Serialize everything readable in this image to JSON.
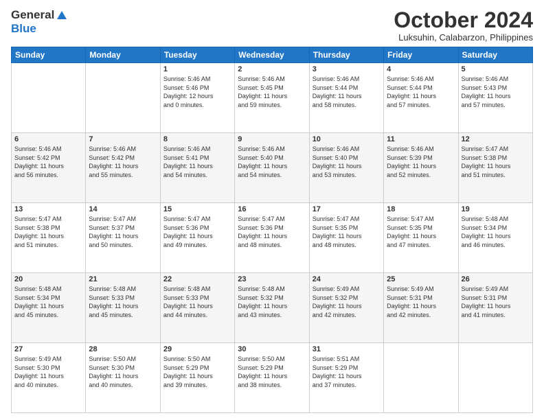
{
  "header": {
    "logo_line1": "General",
    "logo_line2": "Blue",
    "month_title": "October 2024",
    "location": "Luksuhin, Calabarzon, Philippines"
  },
  "days_of_week": [
    "Sunday",
    "Monday",
    "Tuesday",
    "Wednesday",
    "Thursday",
    "Friday",
    "Saturday"
  ],
  "weeks": [
    [
      {
        "day": "",
        "info": ""
      },
      {
        "day": "",
        "info": ""
      },
      {
        "day": "1",
        "info": "Sunrise: 5:46 AM\nSunset: 5:46 PM\nDaylight: 12 hours\nand 0 minutes."
      },
      {
        "day": "2",
        "info": "Sunrise: 5:46 AM\nSunset: 5:45 PM\nDaylight: 11 hours\nand 59 minutes."
      },
      {
        "day": "3",
        "info": "Sunrise: 5:46 AM\nSunset: 5:44 PM\nDaylight: 11 hours\nand 58 minutes."
      },
      {
        "day": "4",
        "info": "Sunrise: 5:46 AM\nSunset: 5:44 PM\nDaylight: 11 hours\nand 57 minutes."
      },
      {
        "day": "5",
        "info": "Sunrise: 5:46 AM\nSunset: 5:43 PM\nDaylight: 11 hours\nand 57 minutes."
      }
    ],
    [
      {
        "day": "6",
        "info": "Sunrise: 5:46 AM\nSunset: 5:42 PM\nDaylight: 11 hours\nand 56 minutes."
      },
      {
        "day": "7",
        "info": "Sunrise: 5:46 AM\nSunset: 5:42 PM\nDaylight: 11 hours\nand 55 minutes."
      },
      {
        "day": "8",
        "info": "Sunrise: 5:46 AM\nSunset: 5:41 PM\nDaylight: 11 hours\nand 54 minutes."
      },
      {
        "day": "9",
        "info": "Sunrise: 5:46 AM\nSunset: 5:40 PM\nDaylight: 11 hours\nand 54 minutes."
      },
      {
        "day": "10",
        "info": "Sunrise: 5:46 AM\nSunset: 5:40 PM\nDaylight: 11 hours\nand 53 minutes."
      },
      {
        "day": "11",
        "info": "Sunrise: 5:46 AM\nSunset: 5:39 PM\nDaylight: 11 hours\nand 52 minutes."
      },
      {
        "day": "12",
        "info": "Sunrise: 5:47 AM\nSunset: 5:38 PM\nDaylight: 11 hours\nand 51 minutes."
      }
    ],
    [
      {
        "day": "13",
        "info": "Sunrise: 5:47 AM\nSunset: 5:38 PM\nDaylight: 11 hours\nand 51 minutes."
      },
      {
        "day": "14",
        "info": "Sunrise: 5:47 AM\nSunset: 5:37 PM\nDaylight: 11 hours\nand 50 minutes."
      },
      {
        "day": "15",
        "info": "Sunrise: 5:47 AM\nSunset: 5:36 PM\nDaylight: 11 hours\nand 49 minutes."
      },
      {
        "day": "16",
        "info": "Sunrise: 5:47 AM\nSunset: 5:36 PM\nDaylight: 11 hours\nand 48 minutes."
      },
      {
        "day": "17",
        "info": "Sunrise: 5:47 AM\nSunset: 5:35 PM\nDaylight: 11 hours\nand 48 minutes."
      },
      {
        "day": "18",
        "info": "Sunrise: 5:47 AM\nSunset: 5:35 PM\nDaylight: 11 hours\nand 47 minutes."
      },
      {
        "day": "19",
        "info": "Sunrise: 5:48 AM\nSunset: 5:34 PM\nDaylight: 11 hours\nand 46 minutes."
      }
    ],
    [
      {
        "day": "20",
        "info": "Sunrise: 5:48 AM\nSunset: 5:34 PM\nDaylight: 11 hours\nand 45 minutes."
      },
      {
        "day": "21",
        "info": "Sunrise: 5:48 AM\nSunset: 5:33 PM\nDaylight: 11 hours\nand 45 minutes."
      },
      {
        "day": "22",
        "info": "Sunrise: 5:48 AM\nSunset: 5:33 PM\nDaylight: 11 hours\nand 44 minutes."
      },
      {
        "day": "23",
        "info": "Sunrise: 5:48 AM\nSunset: 5:32 PM\nDaylight: 11 hours\nand 43 minutes."
      },
      {
        "day": "24",
        "info": "Sunrise: 5:49 AM\nSunset: 5:32 PM\nDaylight: 11 hours\nand 42 minutes."
      },
      {
        "day": "25",
        "info": "Sunrise: 5:49 AM\nSunset: 5:31 PM\nDaylight: 11 hours\nand 42 minutes."
      },
      {
        "day": "26",
        "info": "Sunrise: 5:49 AM\nSunset: 5:31 PM\nDaylight: 11 hours\nand 41 minutes."
      }
    ],
    [
      {
        "day": "27",
        "info": "Sunrise: 5:49 AM\nSunset: 5:30 PM\nDaylight: 11 hours\nand 40 minutes."
      },
      {
        "day": "28",
        "info": "Sunrise: 5:50 AM\nSunset: 5:30 PM\nDaylight: 11 hours\nand 40 minutes."
      },
      {
        "day": "29",
        "info": "Sunrise: 5:50 AM\nSunset: 5:29 PM\nDaylight: 11 hours\nand 39 minutes."
      },
      {
        "day": "30",
        "info": "Sunrise: 5:50 AM\nSunset: 5:29 PM\nDaylight: 11 hours\nand 38 minutes."
      },
      {
        "day": "31",
        "info": "Sunrise: 5:51 AM\nSunset: 5:29 PM\nDaylight: 11 hours\nand 37 minutes."
      },
      {
        "day": "",
        "info": ""
      },
      {
        "day": "",
        "info": ""
      }
    ]
  ]
}
